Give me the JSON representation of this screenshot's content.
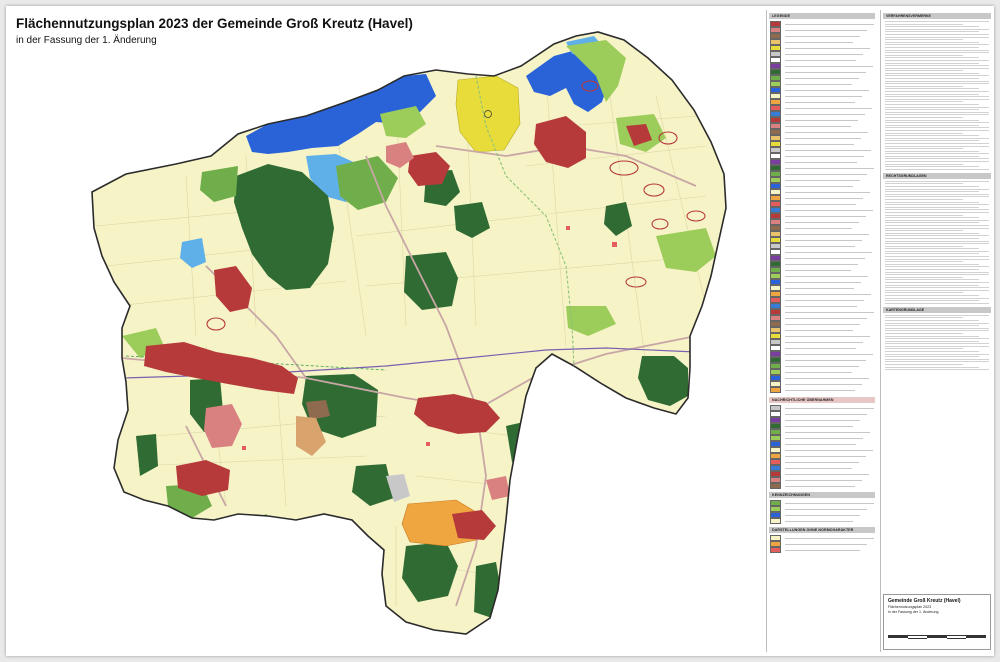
{
  "map": {
    "title": "Flächennutzungsplan 2023 der Gemeinde Groß Kreutz (Havel)",
    "subtitle": "in der Fassung der 1. Änderung",
    "colors": {
      "agriculture": "#f6f3c7",
      "forest": "#2f6b33",
      "forest_light": "#6fae4a",
      "green": "#9ccc5a",
      "water": "#2a63d8",
      "water_light": "#5fb0e8",
      "settlement": "#b63a3a",
      "mixed": "#d9a36e",
      "special": "#e8dc3a",
      "solar": "#f0a640",
      "boundary": "#2b2b2b",
      "road": "#c9a6a6"
    }
  },
  "legend": {
    "sections": [
      "LEGENDE",
      "NACHRICHTLICHE ÜBERNAHMEN",
      "KENNZEICHNUNGEN",
      "DARSTELLUNGEN OHNE NORMCHARAKTER"
    ],
    "swatch_colors": [
      "#b63a3a",
      "#d98080",
      "#8e6b4f",
      "#e8c36b",
      "#e8dc3a",
      "#c8c8c8",
      "#ffffff",
      "#7a3ea0",
      "#2f6b33",
      "#6fae4a",
      "#9ccc5a",
      "#2a63d8",
      "#f6f3c7",
      "#f0a640",
      "#e35d5d",
      "#3a7bd5"
    ]
  },
  "notes": {
    "sections": [
      "VERFAHRENSVERMERKE",
      "RECHTSGRUNDLAGEN",
      "KARTENGRUNDLAGE"
    ]
  },
  "titleblock": {
    "name": "Gemeinde Groß Kreutz (Havel)",
    "plan": "Flächennutzungsplan 2023",
    "version": "in der Fassung der 1. Änderung"
  }
}
